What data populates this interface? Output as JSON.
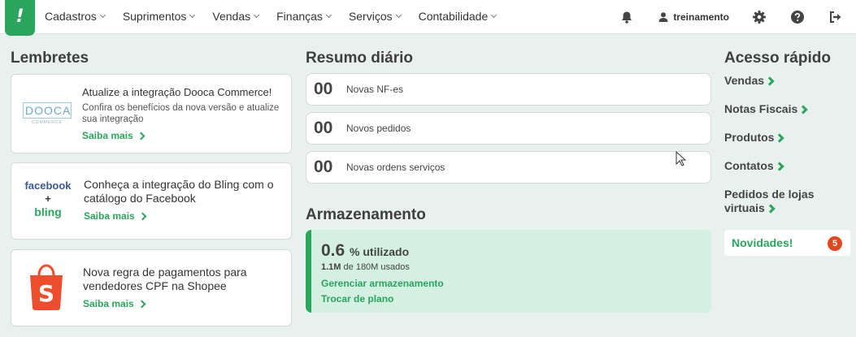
{
  "logo": {
    "text": "!"
  },
  "nav": [
    {
      "label": "Cadastros"
    },
    {
      "label": "Suprimentos"
    },
    {
      "label": "Vendas"
    },
    {
      "label": "Finanças"
    },
    {
      "label": "Serviços"
    },
    {
      "label": "Contabilidade"
    }
  ],
  "topbar": {
    "notification_icon": "bell-icon",
    "user_icon": "user-icon",
    "username": "treinamento",
    "settings_icon": "gear-icon",
    "help_icon": "help-icon",
    "logout_icon": "logout-icon"
  },
  "lembretes": {
    "title": "Lembretes",
    "items": [
      {
        "image": "dooca-commerce-logo",
        "logo_text": "DOOCA",
        "logo_subtext": "COMMERCE",
        "title": "Atualize a integração Dooca Commerce!",
        "description": "Confira os benefícios da nova versão e atualize sua integração",
        "link": "Saiba mais"
      },
      {
        "image": "facebook-bling-logo",
        "logo_text_top": "facebook",
        "logo_plus": "+",
        "logo_text_bottom": "bling",
        "title": "Conheça a integração do Bling com o catálogo do Facebook",
        "link": "Saiba mais"
      },
      {
        "image": "shopee-logo",
        "title": "Nova regra de pagamentos para vendedores CPF na Shopee",
        "link": "Saiba mais"
      }
    ]
  },
  "resumo": {
    "title": "Resumo diário",
    "items": [
      {
        "value": "00",
        "label": "Novas NF-es"
      },
      {
        "value": "00",
        "label": "Novos pedidos"
      },
      {
        "value": "00",
        "label": "Novas ordens serviços"
      }
    ]
  },
  "armazenamento": {
    "title": "Armazenamento",
    "used_value": "0.6",
    "used_suffix": "% utilizado",
    "usage_bold": "1.1M",
    "usage_rest": "de 180M usados",
    "manage_link": "Gerenciar armazenamento",
    "plan_link": "Trocar de plano"
  },
  "acesso": {
    "title": "Acesso rápido",
    "links": [
      {
        "label": "Vendas"
      },
      {
        "label": "Notas Fiscais"
      },
      {
        "label": "Produtos"
      },
      {
        "label": "Contatos"
      },
      {
        "label": "Pedidos de lojas virtuais"
      }
    ]
  },
  "novidades": {
    "label": "Novidades!",
    "count": "5"
  },
  "colors": {
    "brand_green": "#2aa55d",
    "badge": "#e1461e",
    "background": "#e9f1ef"
  }
}
